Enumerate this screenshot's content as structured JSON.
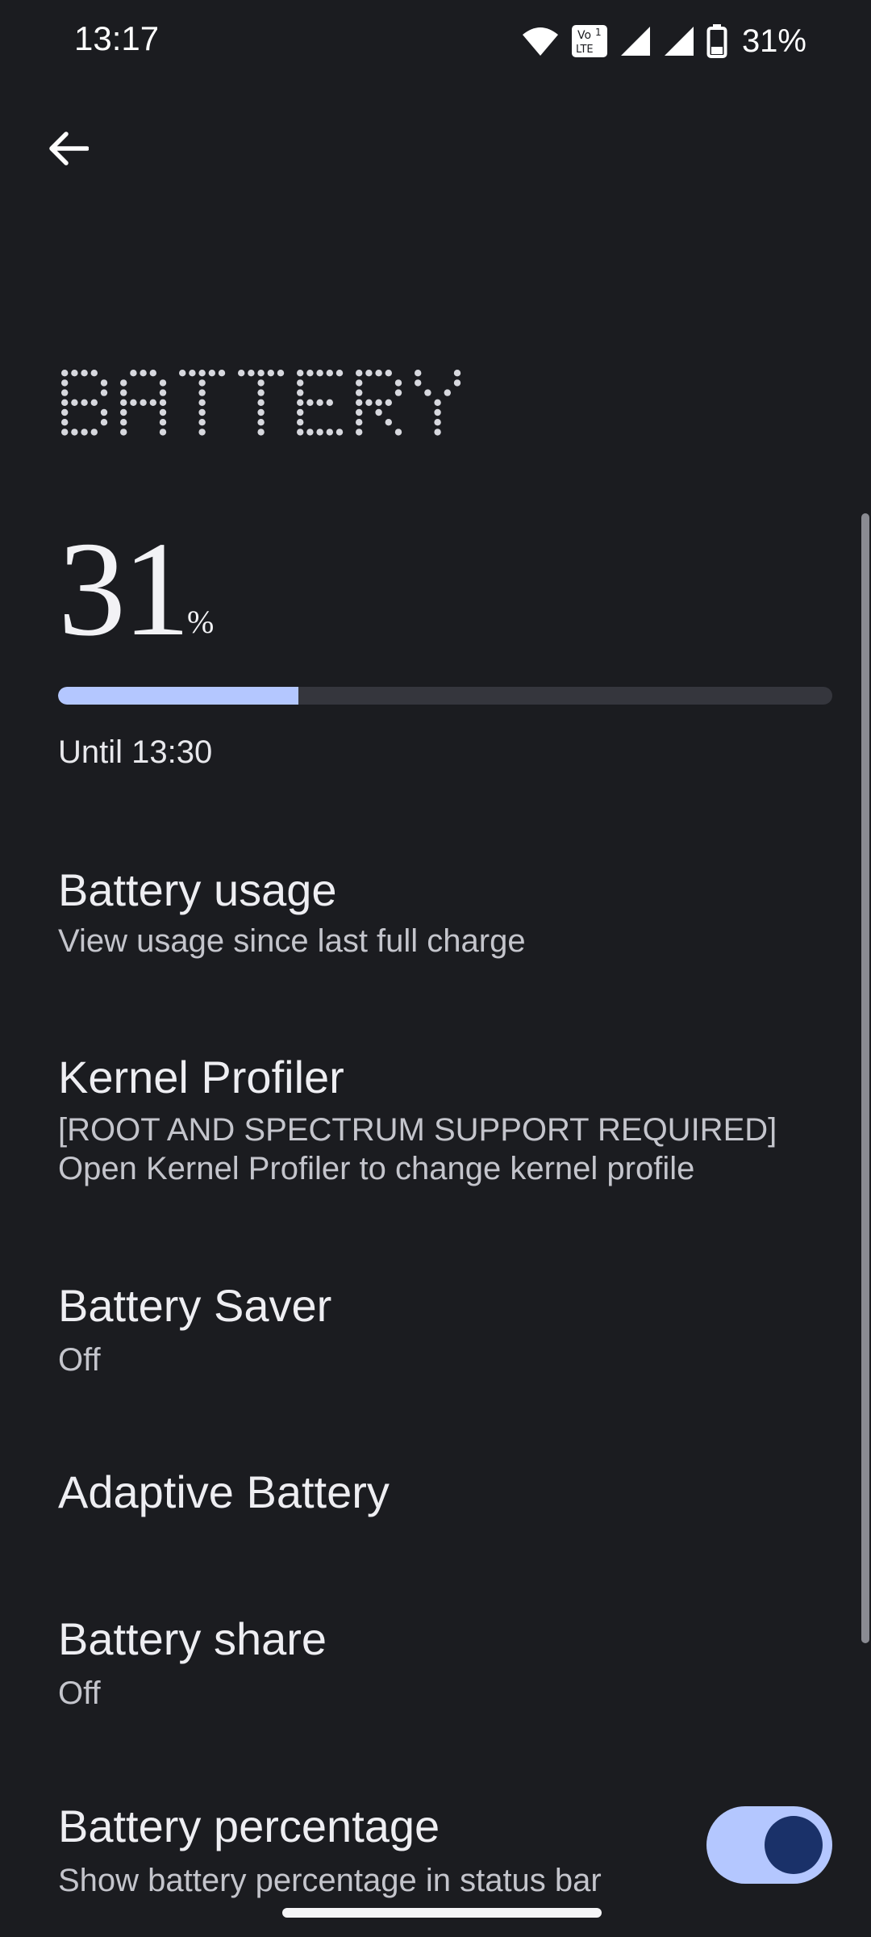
{
  "status_bar": {
    "time": "13:17",
    "battery_percent": "31%",
    "volte_top": "Vo",
    "volte_bottom": "LTE",
    "volte_sim": "1",
    "icons": [
      "wifi-icon",
      "volte-icon",
      "signal-icon",
      "signal-icon",
      "battery-icon"
    ]
  },
  "app_bar": {
    "back_icon": "arrow-left-icon"
  },
  "page": {
    "title": "BATTERY"
  },
  "battery": {
    "level": "31",
    "unit": "%",
    "level_fraction": 0.31,
    "until": "Until 13:30"
  },
  "prefs": {
    "usage": {
      "title": "Battery usage",
      "summary": "View usage since last full charge"
    },
    "kernel": {
      "title": "Kernel Profiler",
      "summary_line1": "[ROOT AND SPECTRUM SUPPORT REQUIRED]",
      "summary_line2": "Open Kernel Profiler to change kernel profile"
    },
    "saver": {
      "title": "Battery Saver",
      "summary": "Off"
    },
    "adaptive": {
      "title": "Adaptive Battery"
    },
    "share": {
      "title": "Battery share",
      "summary": "Off"
    },
    "percentage": {
      "title": "Battery percentage",
      "summary": "Show battery percentage in status bar",
      "enabled": true
    }
  },
  "colors": {
    "background": "#1b1c20",
    "accent": "#b4c7ff",
    "toggle_knob": "#1a3169",
    "track": "#35363d"
  }
}
